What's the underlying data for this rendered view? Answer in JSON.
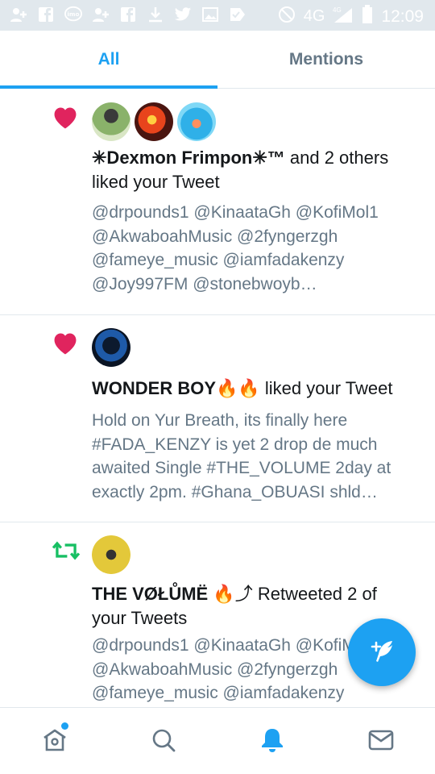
{
  "status_bar": {
    "network": "4G",
    "network_sup": "4G",
    "time": "12:09",
    "left_icons": [
      "add-user-icon",
      "facebook-icon",
      "imo-icon",
      "add-user-icon",
      "facebook-icon",
      "download-icon",
      "twitter-icon",
      "image-icon",
      "check-icon"
    ]
  },
  "tabs": {
    "all": "All",
    "mentions": "Mentions",
    "active": "All"
  },
  "notifications": [
    {
      "type": "like",
      "actor": "✳Dexmon Frimpon✳™",
      "rest": " and 2 others liked your Tweet",
      "body": "@drpounds1 @KinaataGh @KofiMol1 @AkwaboahMusic @2fyngerzgh @fameye_music @iamfadakenzy @Joy997FM @stonebwoyb…"
    },
    {
      "type": "like",
      "actor": "WONDER BOY🔥🔥",
      "rest": " liked your Tweet",
      "body": "Hold on Yur Breath, its finally here #FADA_KENZY is yet 2 drop de much awaited Single #THE_VOLUME 2day at exactly 2pm. #Ghana_OBUASI shld…"
    },
    {
      "type": "retweet",
      "actor": "THE VØŁŮMË",
      "actor_suffix": " 🔥⤴ ",
      "rest": "Retweeted 2 of your Tweets",
      "body": "@drpounds1 @KinaataGh @KofiMol1 @AkwaboahMusic @2fyngerzgh @fameye_music @iamfadakenzy"
    }
  ],
  "colors": {
    "accent": "#1da1f2",
    "like": "#e0245e",
    "retweet": "#17bf63",
    "muted": "#657786"
  },
  "bottom_nav": [
    "home-icon",
    "search-icon",
    "bell-icon",
    "mail-icon"
  ]
}
